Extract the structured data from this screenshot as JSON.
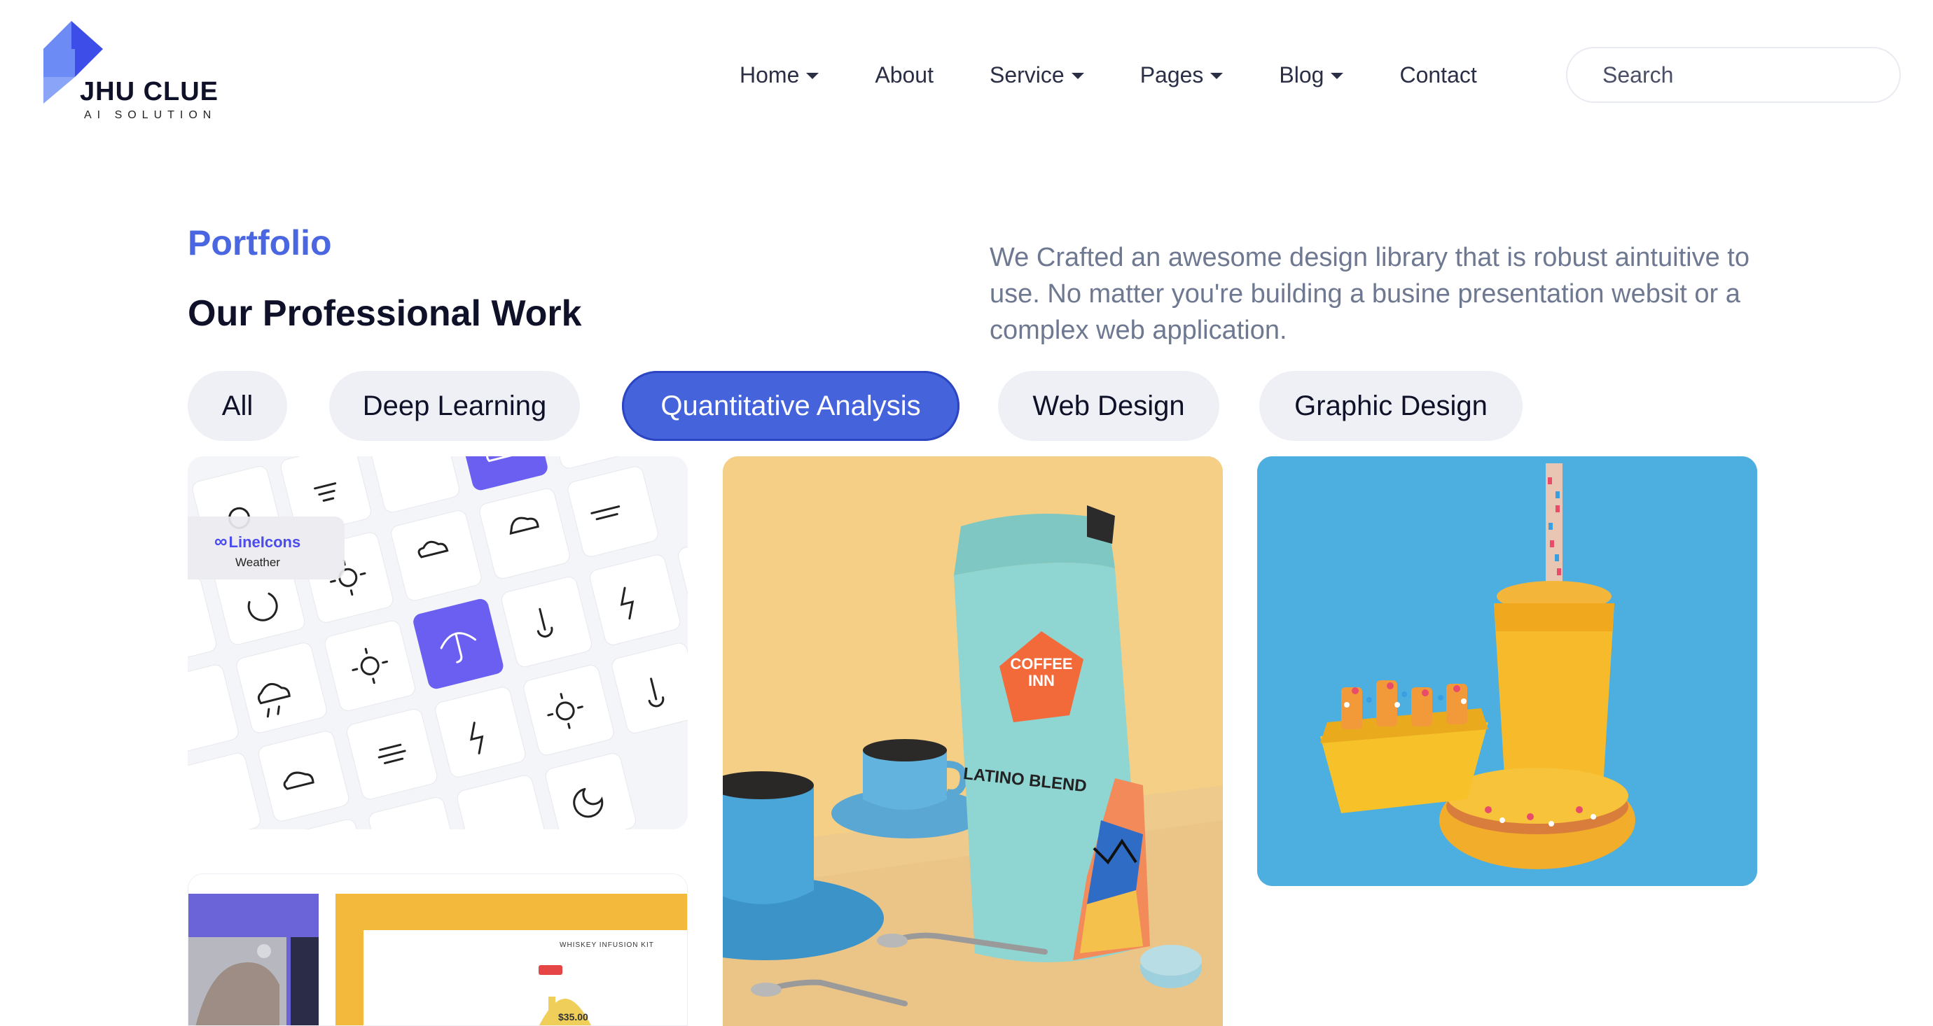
{
  "brand": {
    "name": "JHU CLUE",
    "tagline": "AI SOLUTION",
    "colors": {
      "logo_dark": "#3d4ee8",
      "logo_light": "#6d8bf5"
    }
  },
  "nav": {
    "items": [
      {
        "label": "Home",
        "dropdown": true
      },
      {
        "label": "About",
        "dropdown": false
      },
      {
        "label": "Service",
        "dropdown": true
      },
      {
        "label": "Pages",
        "dropdown": true
      },
      {
        "label": "Blog",
        "dropdown": true
      },
      {
        "label": "Contact",
        "dropdown": false
      }
    ],
    "search": {
      "placeholder": "Search",
      "value": "",
      "icon": "search-icon"
    }
  },
  "section": {
    "eyebrow": "Portfolio",
    "title": "Our Professional Work",
    "description": "We Crafted an awesome design library that is robust aintuitive to use. No matter you're building a busine presentation websit or a complex web application."
  },
  "filters": {
    "items": [
      "All",
      "Deep Learning",
      "Quantitative Analysis",
      "Web Design",
      "Graphic Design"
    ],
    "active": "Quantitative Analysis",
    "colors": {
      "active_bg": "#4563db",
      "inactive_bg": "#eef0f5"
    }
  },
  "portfolio": {
    "items": [
      {
        "image": "weather-icons-grid",
        "badge_brand": "LineIcons",
        "badge_subtitle": "Weather"
      },
      {
        "image": "coffee-bag-photo",
        "bag_brand": "COFFEE INN",
        "bag_title": "LATINO BLEND"
      },
      {
        "image": "yellow-cup-and-donut-photo"
      },
      {
        "image": "ecommerce-ui-mockup",
        "mockup_heading": "WHISKEY INFUSION KIT",
        "mockup_price": "$35.00"
      }
    ]
  }
}
